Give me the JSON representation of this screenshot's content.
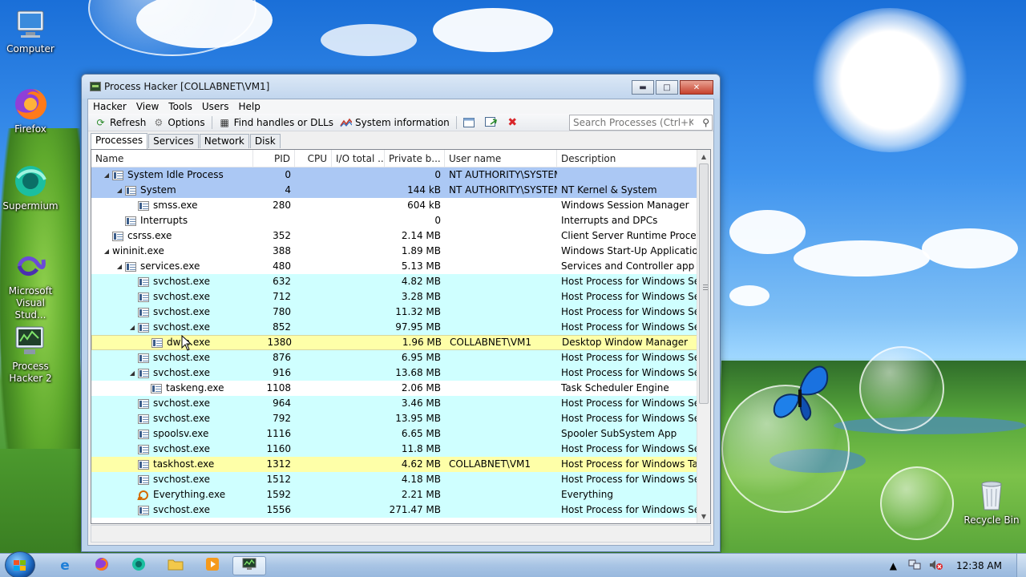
{
  "desktop": {
    "icons": [
      {
        "label": "Computer"
      },
      {
        "label": "Firefox"
      },
      {
        "label": "Supermium"
      },
      {
        "label": "Microsoft Visual Stud..."
      },
      {
        "label": "Process Hacker 2"
      },
      {
        "label": "Recycle Bin"
      }
    ]
  },
  "window": {
    "title": "Process Hacker [COLLABNET\\VM1]",
    "menu": [
      "Hacker",
      "View",
      "Tools",
      "Users",
      "Help"
    ],
    "toolbar": {
      "refresh": "Refresh",
      "options": "Options",
      "find": "Find handles or DLLs",
      "sysinfo": "System information"
    },
    "search_placeholder": "Search Processes (Ctrl+K)",
    "tabs": [
      "Processes",
      "Services",
      "Network",
      "Disk"
    ],
    "columns": {
      "name": "Name",
      "pid": "PID",
      "cpu": "CPU",
      "io": "I/O total ...",
      "private": "Private b...",
      "user": "User name",
      "desc": "Description"
    },
    "rows": [
      {
        "name": "System Idle Process",
        "pid": "0",
        "private": "0",
        "user": "NT AUTHORITY\\SYSTEM",
        "desc": ""
      },
      {
        "name": "System",
        "pid": "4",
        "private": "144 kB",
        "user": "NT AUTHORITY\\SYSTEM",
        "desc": "NT Kernel & System"
      },
      {
        "name": "smss.exe",
        "pid": "280",
        "private": "604 kB",
        "user": "",
        "desc": "Windows Session Manager"
      },
      {
        "name": "Interrupts",
        "pid": "",
        "private": "0",
        "user": "",
        "desc": "Interrupts and DPCs"
      },
      {
        "name": "csrss.exe",
        "pid": "352",
        "private": "2.14 MB",
        "user": "",
        "desc": "Client Server Runtime Process"
      },
      {
        "name": "wininit.exe",
        "pid": "388",
        "private": "1.89 MB",
        "user": "",
        "desc": "Windows Start-Up Application"
      },
      {
        "name": "services.exe",
        "pid": "480",
        "private": "5.13 MB",
        "user": "",
        "desc": "Services and Controller app"
      },
      {
        "name": "svchost.exe",
        "pid": "632",
        "private": "4.82 MB",
        "user": "",
        "desc": "Host Process for Windows Ser..."
      },
      {
        "name": "svchost.exe",
        "pid": "712",
        "private": "3.28 MB",
        "user": "",
        "desc": "Host Process for Windows Ser..."
      },
      {
        "name": "svchost.exe",
        "pid": "780",
        "private": "11.32 MB",
        "user": "",
        "desc": "Host Process for Windows Ser..."
      },
      {
        "name": "svchost.exe",
        "pid": "852",
        "private": "97.95 MB",
        "user": "",
        "desc": "Host Process for Windows Ser..."
      },
      {
        "name": "dwm.exe",
        "pid": "1380",
        "private": "1.96 MB",
        "user": "COLLABNET\\VM1",
        "desc": "Desktop Window Manager"
      },
      {
        "name": "svchost.exe",
        "pid": "876",
        "private": "6.95 MB",
        "user": "",
        "desc": "Host Process for Windows Ser..."
      },
      {
        "name": "svchost.exe",
        "pid": "916",
        "private": "13.68 MB",
        "user": "",
        "desc": "Host Process for Windows Ser..."
      },
      {
        "name": "taskeng.exe",
        "pid": "1108",
        "private": "2.06 MB",
        "user": "",
        "desc": "Task Scheduler Engine"
      },
      {
        "name": "svchost.exe",
        "pid": "964",
        "private": "3.46 MB",
        "user": "",
        "desc": "Host Process for Windows Ser..."
      },
      {
        "name": "svchost.exe",
        "pid": "792",
        "private": "13.95 MB",
        "user": "",
        "desc": "Host Process for Windows Ser..."
      },
      {
        "name": "spoolsv.exe",
        "pid": "1116",
        "private": "6.65 MB",
        "user": "",
        "desc": "Spooler SubSystem App"
      },
      {
        "name": "svchost.exe",
        "pid": "1160",
        "private": "11.8 MB",
        "user": "",
        "desc": "Host Process for Windows Ser..."
      },
      {
        "name": "taskhost.exe",
        "pid": "1312",
        "private": "4.62 MB",
        "user": "COLLABNET\\VM1",
        "desc": "Host Process for Windows Tas..."
      },
      {
        "name": "svchost.exe",
        "pid": "1512",
        "private": "4.18 MB",
        "user": "",
        "desc": "Host Process for Windows Ser..."
      },
      {
        "name": "Everything.exe",
        "pid": "1592",
        "private": "2.21 MB",
        "user": "",
        "desc": "Everything"
      },
      {
        "name": "svchost.exe",
        "pid": "1556",
        "private": "271.47 MB",
        "user": "",
        "desc": "Host Process for Windows Ser..."
      }
    ]
  },
  "taskbar": {
    "clock": "12:38 AM"
  }
}
